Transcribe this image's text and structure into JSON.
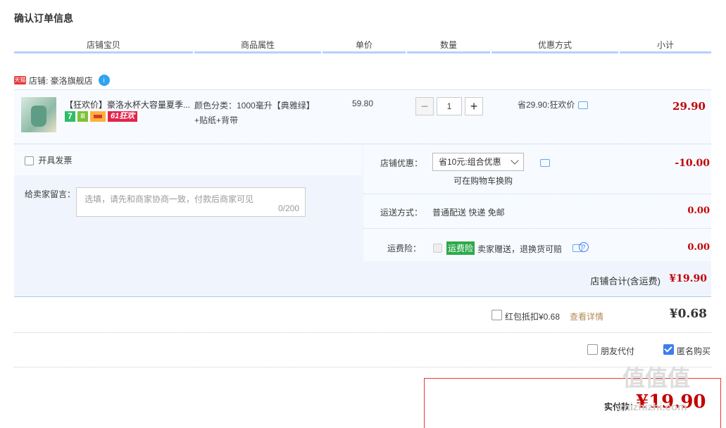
{
  "page_title": "确认订单信息",
  "columns": [
    "店铺宝贝",
    "商品属性",
    "单价",
    "数量",
    "优惠方式",
    "小计"
  ],
  "shop": {
    "badge": "天猫",
    "label": "店铺: 豪洛旗舰店",
    "wang": "i"
  },
  "item": {
    "name": "【狂欢价】豪洛水杯大容量夏季...",
    "badges": {
      "seven": "7",
      "b2": "Ⅲ",
      "b61": "61狂欢"
    },
    "prop_line1": "颜色分类：1000毫升【典雅绿】",
    "prop_line2": "+贴纸+背带",
    "price": "59.80",
    "qty": "1",
    "minus": "−",
    "plus": "+",
    "promo": "省29.90:狂欢价",
    "subtotal": "29.90"
  },
  "invoice": {
    "label": "开具发票"
  },
  "message": {
    "label": "给卖家留言：",
    "placeholder": "选填，请先和商家协商一致，付款后商家可见",
    "counter": "0/200"
  },
  "discount": {
    "label": "店铺优惠：",
    "selected": "省10元:组合优惠",
    "hint": "可在购物车换购",
    "value": "-10.00"
  },
  "shipping": {
    "label": "运送方式：",
    "value": "普通配送 快递 免邮",
    "amount": "0.00"
  },
  "insurance": {
    "label": "运费险：",
    "tag": "运费险",
    "text": "卖家赠送，退换货可赔",
    "amount": "0.00",
    "help": "?"
  },
  "shop_total": {
    "label": "店铺合计(含运费)",
    "value": "¥19.90"
  },
  "redpacket": {
    "label": "红包抵扣¥0.68",
    "link": "查看详情",
    "value": "¥0.68"
  },
  "options": {
    "friend": "朋友代付",
    "anonymous": "匿名购买"
  },
  "pay": {
    "label": "实付款：",
    "value": "¥19.90"
  },
  "watermark": {
    "top": "值值值",
    "bottom": "zhizhizhi.com"
  },
  "colors": {
    "accent": "#c40000",
    "link": "#3b7ef0",
    "header_line": "#b2d1ff",
    "panel": "#f0f5fd"
  }
}
